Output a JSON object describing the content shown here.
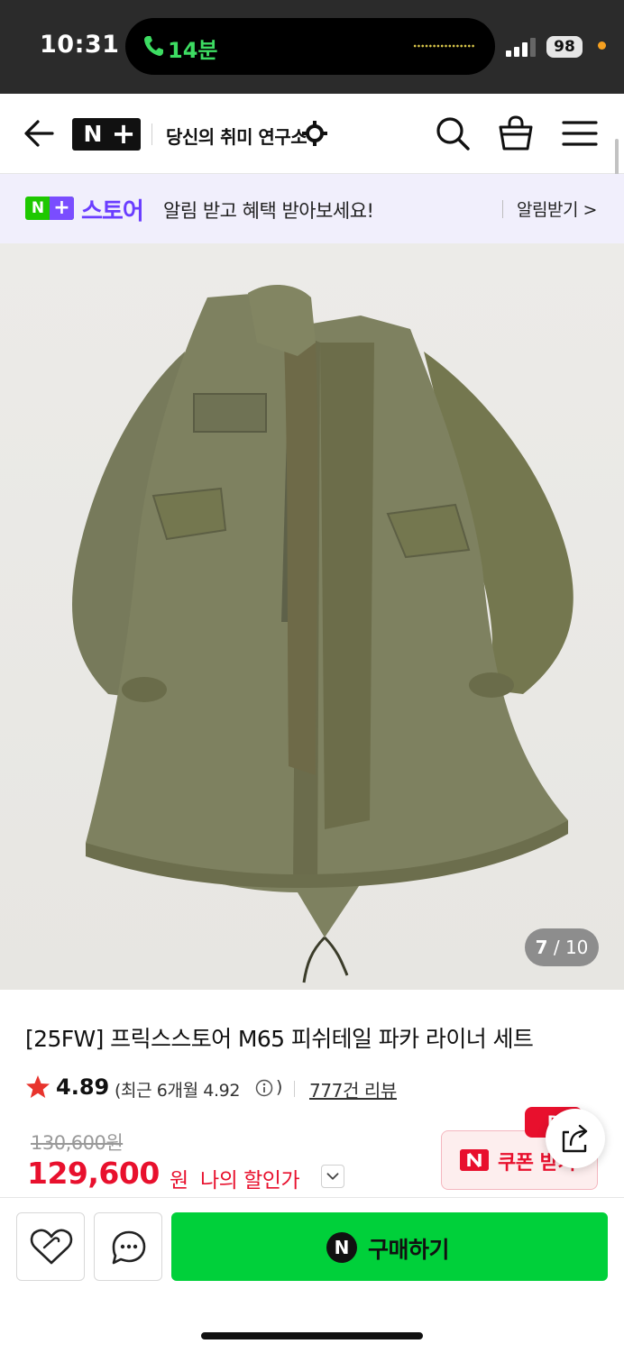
{
  "status_bar": {
    "time": "10:31",
    "call_label": "14분",
    "battery": "98",
    "colors": {
      "call": "#3ddc62",
      "indicator": "#f5a020"
    }
  },
  "header": {
    "logo_n": "N",
    "logo_plus": "+",
    "brand": "당신의 취미 연구소",
    "icons": [
      "back-arrow-icon",
      "search-icon",
      "cart-icon",
      "menu-icon"
    ]
  },
  "promo": {
    "badge_n": "N",
    "badge_plus": "+",
    "store": "스토어",
    "message": "알림 받고 혜택 받아보세요!",
    "button": "알림받기 >",
    "colors": {
      "store": "#6a3dff",
      "badge_green": "#1ec800"
    }
  },
  "image": {
    "counter_current": "7",
    "counter_total": "/ 10"
  },
  "product": {
    "title": "[25FW] 프릭스스토어 M65 피쉬테일 파카 라이너 세트",
    "rating": "4.89",
    "recent_rating": "(최근 6개월 4.92",
    "recent_close": ")",
    "reviews": "777건 리뷰",
    "original_price": "130,600원",
    "price": "129,600",
    "price_unit": "원",
    "my_price_label": "나의 할인가",
    "coupon_label": "쿠폰 받기",
    "coupon_badge": "D",
    "colors": {
      "price": "#e8102d",
      "star": "#e8342d"
    }
  },
  "bottom_bar": {
    "buy_icon": "N",
    "buy_label": "구매하기",
    "colors": {
      "buy": "#00d03a"
    }
  }
}
